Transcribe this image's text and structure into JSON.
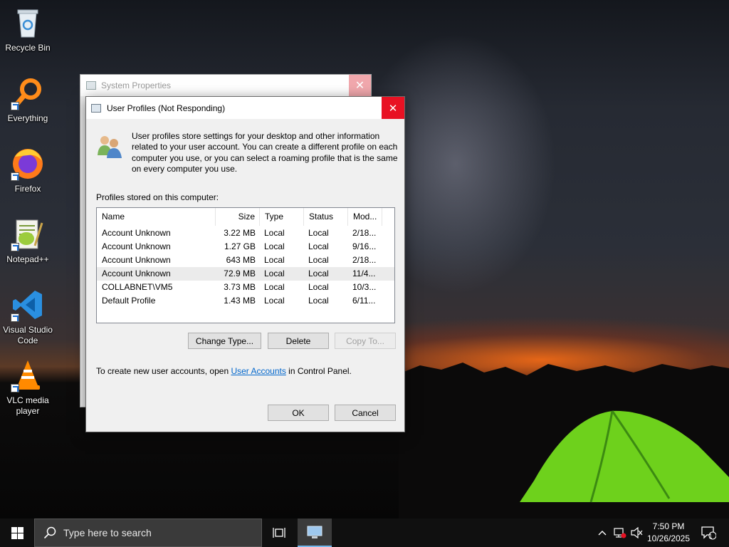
{
  "desktop": {
    "icons": [
      {
        "label": "Recycle Bin",
        "icon": "recycle-bin-icon"
      },
      {
        "label": "Everything",
        "icon": "everything-search-icon"
      },
      {
        "label": "Firefox",
        "icon": "firefox-icon"
      },
      {
        "label": "Notepad++",
        "icon": "notepad-plus-plus-icon"
      },
      {
        "label": "Visual Studio Code",
        "icon": "vscode-icon"
      },
      {
        "label": "VLC media player",
        "icon": "vlc-icon"
      }
    ]
  },
  "system_properties": {
    "title": "System Properties",
    "close_glyph": "✕"
  },
  "user_profiles": {
    "title": "User Profiles (Not Responding)",
    "close_glyph": "✕",
    "intro": "User profiles store settings for your desktop and other information related to your user account. You can create a different profile on each computer you use, or you can select a roaming profile that is the same on every computer you use.",
    "profiles_label": "Profiles stored on this computer:",
    "columns": {
      "name": "Name",
      "size": "Size",
      "type": "Type",
      "status": "Status",
      "modified": "Mod..."
    },
    "rows": [
      {
        "name": "Account Unknown",
        "size": "3.22 MB",
        "type": "Local",
        "status": "Local",
        "modified": "2/18..."
      },
      {
        "name": "Account Unknown",
        "size": "1.27 GB",
        "type": "Local",
        "status": "Local",
        "modified": "9/16..."
      },
      {
        "name": "Account Unknown",
        "size": "643 MB",
        "type": "Local",
        "status": "Local",
        "modified": "2/18..."
      },
      {
        "name": "Account Unknown",
        "size": "72.9 MB",
        "type": "Local",
        "status": "Local",
        "modified": "11/4..."
      },
      {
        "name": "COLLABNET\\VM5",
        "size": "3.73 MB",
        "type": "Local",
        "status": "Local",
        "modified": "10/3..."
      },
      {
        "name": "Default Profile",
        "size": "1.43 MB",
        "type": "Local",
        "status": "Local",
        "modified": "6/11..."
      }
    ],
    "buttons": {
      "change_type": "Change Type...",
      "delete": "Delete",
      "copy_to": "Copy To...",
      "ok": "OK",
      "cancel": "Cancel"
    },
    "create_prefix": "To create new user accounts, open ",
    "create_link": "User Accounts",
    "create_suffix": " in Control Panel."
  },
  "taskbar": {
    "search_placeholder": "Type here to search",
    "time": "7:50 PM",
    "date": "10/26/2025",
    "notification_count": "1"
  }
}
